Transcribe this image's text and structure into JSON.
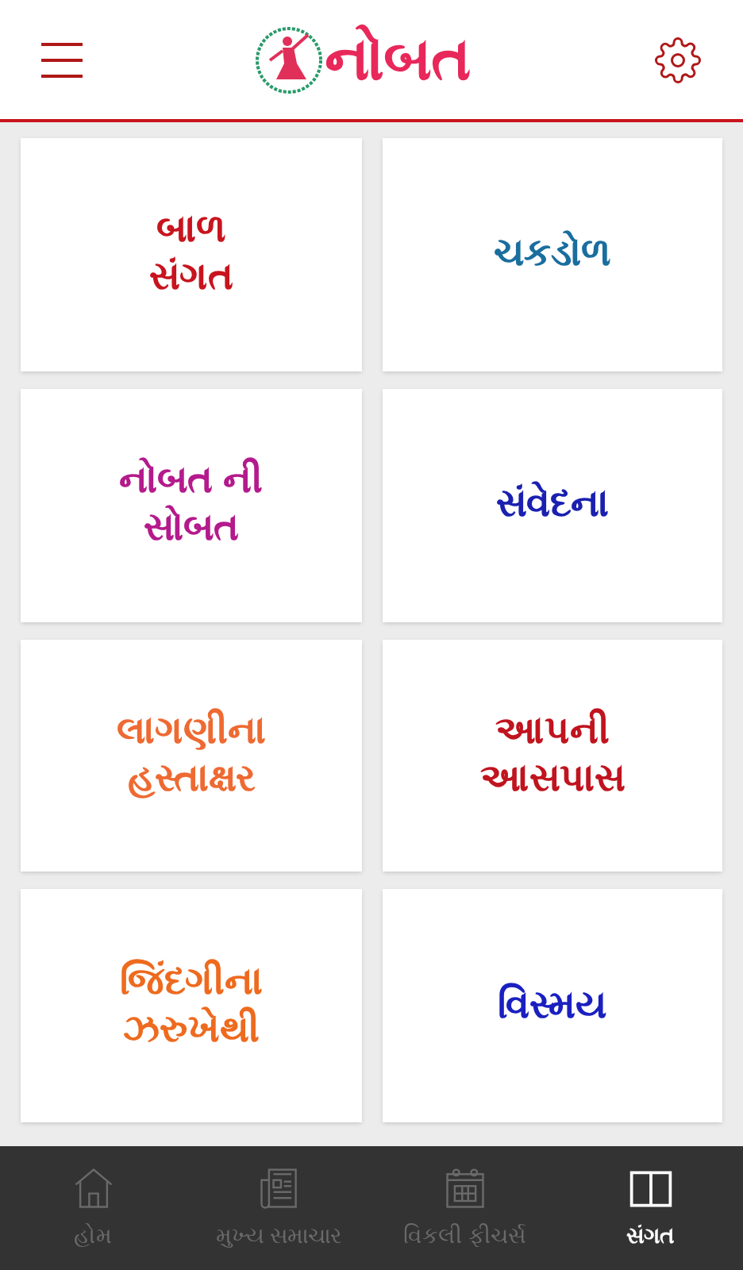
{
  "header": {
    "logo_text": "નોબત"
  },
  "tiles": [
    {
      "lines": [
        "બાળ",
        "સંગત"
      ],
      "color": "#c8141e"
    },
    {
      "lines": [
        "ચકડોળ"
      ],
      "color": "#1a6e9e"
    },
    {
      "lines": [
        "નોબત ની",
        "સોબત"
      ],
      "color": "#b41a8c"
    },
    {
      "lines": [
        "સંવેદના"
      ],
      "color": "#1a20b0"
    },
    {
      "lines": [
        "લાગણીના",
        "હસ્તાક્ષર"
      ],
      "color": "#ee6a32"
    },
    {
      "lines": [
        "આપની",
        "આસપાસ"
      ],
      "color": "#c0141e"
    },
    {
      "lines": [
        "જિંદગીના",
        "ઝરુખેથી"
      ],
      "color": "#ee6a1e"
    },
    {
      "lines": [
        "વિસ્મય"
      ],
      "color": "#1a20c0"
    }
  ],
  "bottom_nav": [
    {
      "kind": "home",
      "label": "હોમ",
      "selected": false
    },
    {
      "kind": "news",
      "label": "મુખ્ય સમાચાર",
      "selected": false
    },
    {
      "kind": "calendar",
      "label": "વિકલી ફીચર્સ",
      "selected": false
    },
    {
      "kind": "book",
      "label": "સંગત",
      "selected": true
    }
  ]
}
